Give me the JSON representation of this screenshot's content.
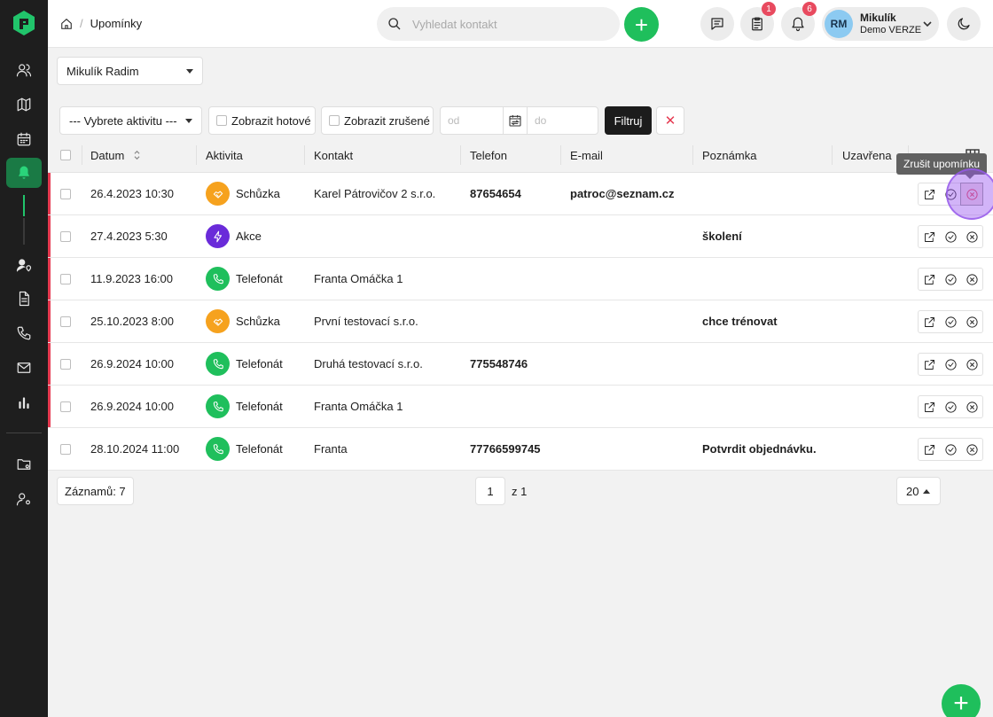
{
  "header": {
    "breadcrumb_page": "Upomínky",
    "search_placeholder": "Vyhledat kontakt",
    "tasks_badge": "1",
    "notifications_badge": "6",
    "user_initials": "RM",
    "user_name": "Mikulík",
    "user_role": "Demo VERZE"
  },
  "person_select": {
    "value": "Mikulík Radim"
  },
  "filters": {
    "activity_select": "--- Vybrete aktivitu ---",
    "show_done": "Zobrazit hotové",
    "show_cancelled": "Zobrazit zrušené",
    "date_from_placeholder": "od",
    "date_to_placeholder": "do",
    "filter_button": "Filtruj",
    "clear_button": "✕"
  },
  "table": {
    "columns": {
      "datum": "Datum",
      "aktivita": "Aktivita",
      "kontakt": "Kontakt",
      "telefon": "Telefon",
      "email": "E-mail",
      "poznamka": "Poznámka",
      "uzavrena": "Uzavřena"
    },
    "rows": [
      {
        "datum": "26.4.2023 10:30",
        "aktivita": "Schůzka",
        "activity_type": "meeting",
        "kontakt": "Karel Pátrovičov 2 s.r.o.",
        "telefon": "87654654",
        "email": "patroc@seznam.cz",
        "poznamka": ""
      },
      {
        "datum": "27.4.2023 5:30",
        "aktivita": "Akce",
        "activity_type": "event",
        "kontakt": "",
        "telefon": "",
        "email": "",
        "poznamka": "školení"
      },
      {
        "datum": "11.9.2023 16:00",
        "aktivita": "Telefonát",
        "activity_type": "call",
        "kontakt": "Franta Omáčka 1",
        "telefon": "",
        "email": "",
        "poznamka": ""
      },
      {
        "datum": "25.10.2023 8:00",
        "aktivita": "Schůzka",
        "activity_type": "meeting",
        "kontakt": "První testovací s.r.o.",
        "telefon": "",
        "email": "",
        "poznamka": "chce trénovat"
      },
      {
        "datum": "26.9.2024 10:00",
        "aktivita": "Telefonát",
        "activity_type": "call",
        "kontakt": "Druhá testovací s.r.o.",
        "telefon": "775548746",
        "email": "",
        "poznamka": ""
      },
      {
        "datum": "26.9.2024 10:00",
        "aktivita": "Telefonát",
        "activity_type": "call",
        "kontakt": "Franta Omáčka 1",
        "telefon": "",
        "email": "",
        "poznamka": ""
      },
      {
        "datum": "28.10.2024 11:00",
        "aktivita": "Telefonát",
        "activity_type": "call",
        "kontakt": "Franta",
        "telefon": "77766599745",
        "email": "",
        "poznamka": "Potvrdit objednávku."
      }
    ]
  },
  "tooltip": "Zrušit upomínku",
  "footer": {
    "record_count": "Záznamů: 7",
    "page": "1",
    "page_of": "z 1",
    "per_page": "20"
  },
  "colors": {
    "accent_green": "#1fbf5c",
    "overdue_red": "#e53950",
    "meeting_orange": "#f6a21e",
    "event_purple": "#6a2bd9",
    "call_green": "#1fbf5c"
  }
}
